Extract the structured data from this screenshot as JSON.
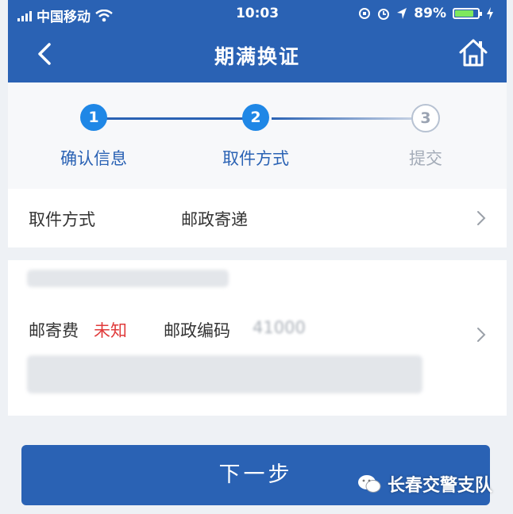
{
  "status_bar": {
    "carrier": "中国移动",
    "time": "10:03",
    "battery": "89%",
    "battery_level": 0.89
  },
  "nav": {
    "title": "期满换证",
    "back_icon": "chevron-left-icon",
    "home_icon": "home-icon"
  },
  "steps": [
    {
      "number": "1",
      "label": "确认信息",
      "state": "done"
    },
    {
      "number": "2",
      "label": "取件方式",
      "state": "current"
    },
    {
      "number": "3",
      "label": "提交",
      "state": "pending"
    }
  ],
  "pickup": {
    "label": "取件方式",
    "value": "邮政寄递"
  },
  "address": {
    "postage_label": "邮寄费",
    "postage_value": "未知",
    "postcode_label": "邮政编码",
    "postcode_value": "41000"
  },
  "next_button": "下一步",
  "watermark": "长春交警支队",
  "colors": {
    "primary": "#2a62b4",
    "step_active": "#1f87e6",
    "warning_text": "#e03b3b"
  }
}
